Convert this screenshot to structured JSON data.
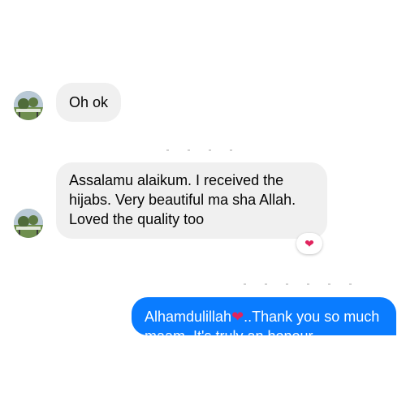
{
  "conversation": {
    "messages": [
      {
        "direction": "incoming",
        "text": "Oh ok"
      },
      {
        "direction": "incoming",
        "text": "Assalamu alaikum. I received the hijabs. Very beautiful ma sha Allah. Loved the quality too",
        "reaction": "❤"
      },
      {
        "direction": "outgoing",
        "text_before_emoji": "Alhamdulillah",
        "emoji": "❤",
        "text_after_emoji": "..Thank you so much maam. It's truly an honour"
      }
    ]
  },
  "colors": {
    "incoming_bubble": "#f0f0f0",
    "outgoing_bubble": "#0a7cff",
    "reaction_heart": "#e0245e"
  },
  "icons": {
    "avatar": "landscape-photo-avatar",
    "reaction": "red-heart-icon"
  }
}
